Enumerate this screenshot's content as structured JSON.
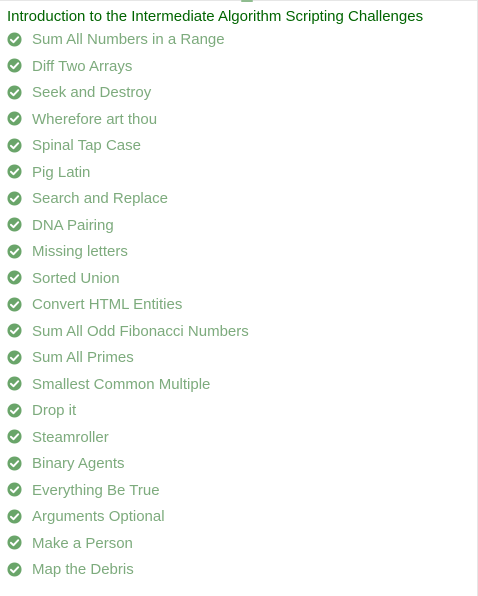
{
  "section": {
    "title": "Introduction to the Intermediate Algorithm Scripting Challenges"
  },
  "colors": {
    "title": "#006400",
    "completed_text": "#7dab7d",
    "check_circle": "#6aa56a",
    "check_mark": "#ffffff"
  },
  "challenges": [
    {
      "label": "Sum All Numbers in a Range",
      "status": "completed",
      "icon": "check-circle-icon"
    },
    {
      "label": "Diff Two Arrays",
      "status": "completed",
      "icon": "check-circle-icon"
    },
    {
      "label": "Seek and Destroy",
      "status": "completed",
      "icon": "check-circle-icon"
    },
    {
      "label": "Wherefore art thou",
      "status": "completed",
      "icon": "check-circle-icon"
    },
    {
      "label": "Spinal Tap Case",
      "status": "completed",
      "icon": "check-circle-icon"
    },
    {
      "label": "Pig Latin",
      "status": "completed",
      "icon": "check-circle-icon"
    },
    {
      "label": "Search and Replace",
      "status": "completed",
      "icon": "check-circle-icon"
    },
    {
      "label": "DNA Pairing",
      "status": "completed",
      "icon": "check-circle-icon"
    },
    {
      "label": "Missing letters",
      "status": "completed",
      "icon": "check-circle-icon"
    },
    {
      "label": "Sorted Union",
      "status": "completed",
      "icon": "check-circle-icon"
    },
    {
      "label": "Convert HTML Entities",
      "status": "completed",
      "icon": "check-circle-icon"
    },
    {
      "label": "Sum All Odd Fibonacci Numbers",
      "status": "completed",
      "icon": "check-circle-icon"
    },
    {
      "label": "Sum All Primes",
      "status": "completed",
      "icon": "check-circle-icon"
    },
    {
      "label": "Smallest Common Multiple",
      "status": "completed",
      "icon": "check-circle-icon"
    },
    {
      "label": "Drop it",
      "status": "completed",
      "icon": "check-circle-icon"
    },
    {
      "label": "Steamroller",
      "status": "completed",
      "icon": "check-circle-icon"
    },
    {
      "label": "Binary Agents",
      "status": "completed",
      "icon": "check-circle-icon"
    },
    {
      "label": "Everything Be True",
      "status": "completed",
      "icon": "check-circle-icon"
    },
    {
      "label": "Arguments Optional",
      "status": "completed",
      "icon": "check-circle-icon"
    },
    {
      "label": "Make a Person",
      "status": "completed",
      "icon": "check-circle-icon"
    },
    {
      "label": "Map the Debris",
      "status": "completed",
      "icon": "check-circle-icon"
    }
  ]
}
